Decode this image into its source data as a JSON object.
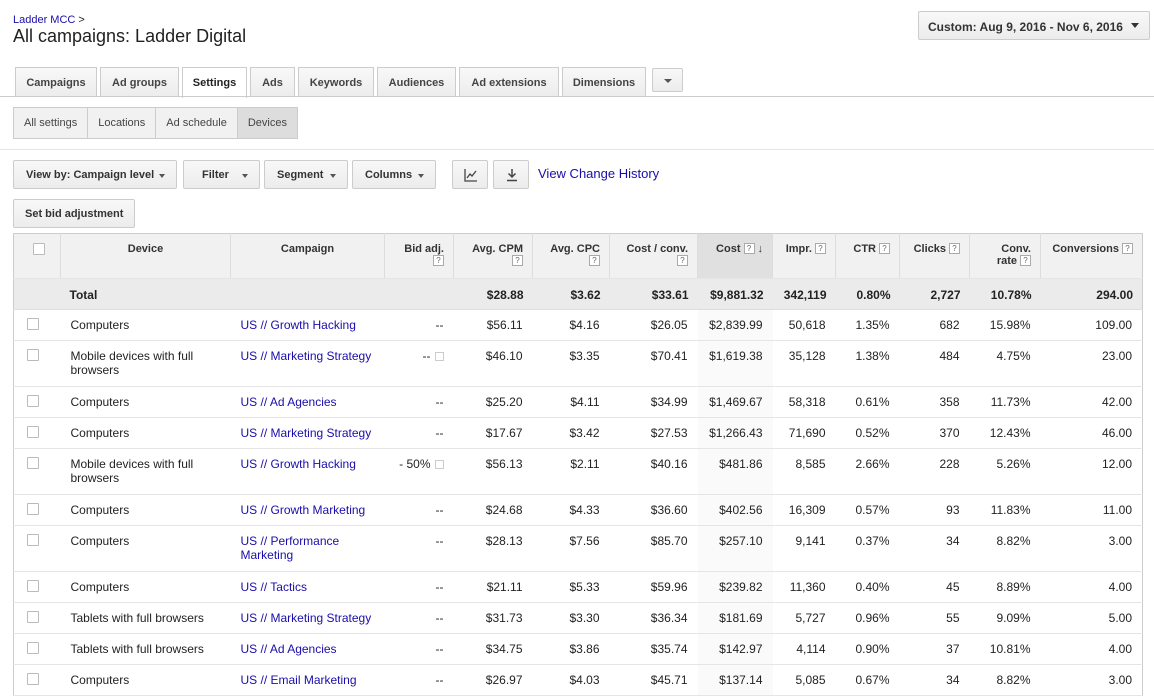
{
  "header": {
    "breadcrumb": "Ladder MCC",
    "breadcrumb_sep": ">",
    "title": "All campaigns: Ladder Digital",
    "date_range": "Custom: Aug 9, 2016 - Nov 6, 2016"
  },
  "tabs": [
    {
      "label": "Campaigns"
    },
    {
      "label": "Ad groups"
    },
    {
      "label": "Settings"
    },
    {
      "label": "Ads"
    },
    {
      "label": "Keywords"
    },
    {
      "label": "Audiences"
    },
    {
      "label": "Ad extensions"
    },
    {
      "label": "Dimensions"
    }
  ],
  "subtabs": [
    {
      "label": "All settings"
    },
    {
      "label": "Locations"
    },
    {
      "label": "Ad schedule"
    },
    {
      "label": "Devices"
    }
  ],
  "toolbar": {
    "view_by": "View by: Campaign level",
    "filter": "Filter",
    "segment": "Segment",
    "columns": "Columns",
    "chart_icon": "line-chart-icon",
    "download_icon": "download-icon",
    "change_history": "View Change History",
    "set_bid": "Set bid adjustment"
  },
  "table": {
    "columns": [
      "Device",
      "Campaign",
      "Bid adj.",
      "Avg. CPM",
      "Avg. CPC",
      "Cost / conv.",
      "Cost",
      "Impr.",
      "CTR",
      "Clicks",
      "Conv. rate",
      "Conversions"
    ],
    "total": {
      "label": "Total",
      "avg_cpm": "$28.88",
      "avg_cpc": "$3.62",
      "cost_conv": "$33.61",
      "cost": "$9,881.32",
      "impr": "342,119",
      "ctr": "0.80%",
      "clicks": "2,727",
      "conv_rate": "10.78%",
      "conversions": "294.00"
    },
    "rows": [
      {
        "device": "Computers",
        "campaign": "US // Growth Hacking",
        "bid": "--",
        "avg_cpm": "$56.11",
        "avg_cpc": "$4.16",
        "cost_conv": "$26.05",
        "cost": "$2,839.99",
        "impr": "50,618",
        "ctr": "1.35%",
        "clicks": "682",
        "conv_rate": "15.98%",
        "conversions": "109.00"
      },
      {
        "device": "Mobile devices with full browsers",
        "campaign": "US // Marketing Strategy",
        "bid": "--",
        "avg_cpm": "$46.10",
        "avg_cpc": "$3.35",
        "cost_conv": "$70.41",
        "cost": "$1,619.38",
        "impr": "35,128",
        "ctr": "1.38%",
        "clicks": "484",
        "conv_rate": "4.75%",
        "conversions": "23.00"
      },
      {
        "device": "Computers",
        "campaign": "US // Ad Agencies",
        "bid": "--",
        "avg_cpm": "$25.20",
        "avg_cpc": "$4.11",
        "cost_conv": "$34.99",
        "cost": "$1,469.67",
        "impr": "58,318",
        "ctr": "0.61%",
        "clicks": "358",
        "conv_rate": "11.73%",
        "conversions": "42.00"
      },
      {
        "device": "Computers",
        "campaign": "US // Marketing Strategy",
        "bid": "--",
        "avg_cpm": "$17.67",
        "avg_cpc": "$3.42",
        "cost_conv": "$27.53",
        "cost": "$1,266.43",
        "impr": "71,690",
        "ctr": "0.52%",
        "clicks": "370",
        "conv_rate": "12.43%",
        "conversions": "46.00"
      },
      {
        "device": "Mobile devices with full browsers",
        "campaign": "US // Growth Hacking",
        "bid": "- 50%",
        "avg_cpm": "$56.13",
        "avg_cpc": "$2.11",
        "cost_conv": "$40.16",
        "cost": "$481.86",
        "impr": "8,585",
        "ctr": "2.66%",
        "clicks": "228",
        "conv_rate": "5.26%",
        "conversions": "12.00"
      },
      {
        "device": "Computers",
        "campaign": "US // Growth Marketing",
        "bid": "--",
        "avg_cpm": "$24.68",
        "avg_cpc": "$4.33",
        "cost_conv": "$36.60",
        "cost": "$402.56",
        "impr": "16,309",
        "ctr": "0.57%",
        "clicks": "93",
        "conv_rate": "11.83%",
        "conversions": "11.00"
      },
      {
        "device": "Computers",
        "campaign": "US // Performance Marketing",
        "bid": "--",
        "avg_cpm": "$28.13",
        "avg_cpc": "$7.56",
        "cost_conv": "$85.70",
        "cost": "$257.10",
        "impr": "9,141",
        "ctr": "0.37%",
        "clicks": "34",
        "conv_rate": "8.82%",
        "conversions": "3.00"
      },
      {
        "device": "Computers",
        "campaign": "US // Tactics",
        "bid": "--",
        "avg_cpm": "$21.11",
        "avg_cpc": "$5.33",
        "cost_conv": "$59.96",
        "cost": "$239.82",
        "impr": "11,360",
        "ctr": "0.40%",
        "clicks": "45",
        "conv_rate": "8.89%",
        "conversions": "4.00"
      },
      {
        "device": "Tablets with full browsers",
        "campaign": "US // Marketing Strategy",
        "bid": "--",
        "avg_cpm": "$31.73",
        "avg_cpc": "$3.30",
        "cost_conv": "$36.34",
        "cost": "$181.69",
        "impr": "5,727",
        "ctr": "0.96%",
        "clicks": "55",
        "conv_rate": "9.09%",
        "conversions": "5.00"
      },
      {
        "device": "Tablets with full browsers",
        "campaign": "US // Ad Agencies",
        "bid": "--",
        "avg_cpm": "$34.75",
        "avg_cpc": "$3.86",
        "cost_conv": "$35.74",
        "cost": "$142.97",
        "impr": "4,114",
        "ctr": "0.90%",
        "clicks": "37",
        "conv_rate": "10.81%",
        "conversions": "4.00"
      },
      {
        "device": "Computers",
        "campaign": "US // Email Marketing",
        "bid": "--",
        "avg_cpm": "$26.97",
        "avg_cpc": "$4.03",
        "cost_conv": "$45.71",
        "cost": "$137.14",
        "impr": "5,085",
        "ctr": "0.67%",
        "clicks": "34",
        "conv_rate": "8.82%",
        "conversions": "3.00"
      }
    ]
  }
}
